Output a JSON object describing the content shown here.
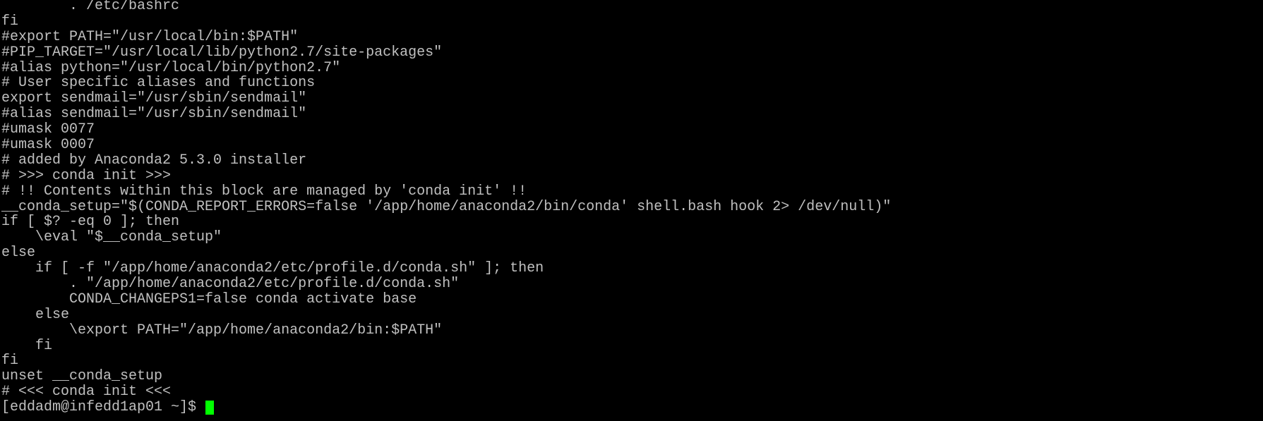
{
  "terminal": {
    "lines": [
      "        . /etc/bashrc",
      "fi",
      "#export PATH=\"/usr/local/bin:$PATH\"",
      "#PIP_TARGET=\"/usr/local/lib/python2.7/site-packages\"",
      "#alias python=\"/usr/local/bin/python2.7\"",
      "# User specific aliases and functions",
      "export sendmail=\"/usr/sbin/sendmail\"",
      "#alias sendmail=\"/usr/sbin/sendmail\"",
      "#umask 0077",
      "#umask 0007",
      "# added by Anaconda2 5.3.0 installer",
      "# >>> conda init >>>",
      "# !! Contents within this block are managed by 'conda init' !!",
      "__conda_setup=\"$(CONDA_REPORT_ERRORS=false '/app/home/anaconda2/bin/conda' shell.bash hook 2> /dev/null)\"",
      "if [ $? -eq 0 ]; then",
      "    \\eval \"$__conda_setup\"",
      "else",
      "    if [ -f \"/app/home/anaconda2/etc/profile.d/conda.sh\" ]; then",
      "        . \"/app/home/anaconda2/etc/profile.d/conda.sh\"",
      "        CONDA_CHANGEPS1=false conda activate base",
      "    else",
      "        \\export PATH=\"/app/home/anaconda2/bin:$PATH\"",
      "    fi",
      "fi",
      "unset __conda_setup",
      "# <<< conda init <<<"
    ],
    "prompt": "[eddadm@infedd1ap01 ~]$ ",
    "colors": {
      "background": "#000000",
      "foreground": "#c0c0c0",
      "cursor": "#00ff00"
    }
  }
}
